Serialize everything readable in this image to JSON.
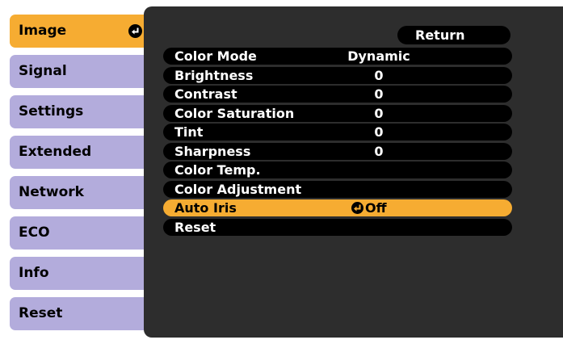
{
  "sidebar": {
    "items": [
      {
        "label": "Image",
        "active": true
      },
      {
        "label": "Signal",
        "active": false
      },
      {
        "label": "Settings",
        "active": false
      },
      {
        "label": "Extended",
        "active": false
      },
      {
        "label": "Network",
        "active": false
      },
      {
        "label": "ECO",
        "active": false
      },
      {
        "label": "Info",
        "active": false
      },
      {
        "label": "Reset",
        "active": false
      }
    ]
  },
  "panel": {
    "return_label": "Return",
    "rows": [
      {
        "label": "Color Mode",
        "value": "Dynamic"
      },
      {
        "label": "Brightness",
        "value": "0"
      },
      {
        "label": "Contrast",
        "value": "0"
      },
      {
        "label": "Color Saturation",
        "value": "0"
      },
      {
        "label": "Tint",
        "value": "0"
      },
      {
        "label": "Sharpness",
        "value": "0"
      },
      {
        "label": "Color Temp.",
        "value": ""
      },
      {
        "label": "Color Adjustment",
        "value": ""
      },
      {
        "label": "Auto Iris",
        "value": "Off"
      },
      {
        "label": "Reset",
        "value": ""
      }
    ]
  },
  "colors": {
    "sidebar_item": "#b3acdc",
    "sidebar_active": "#f6ac32",
    "panel_bg": "#2d2d2d",
    "row_bg": "#000000",
    "row_highlight": "#f6ac32"
  },
  "icons": {
    "enter": "enter-icon"
  }
}
